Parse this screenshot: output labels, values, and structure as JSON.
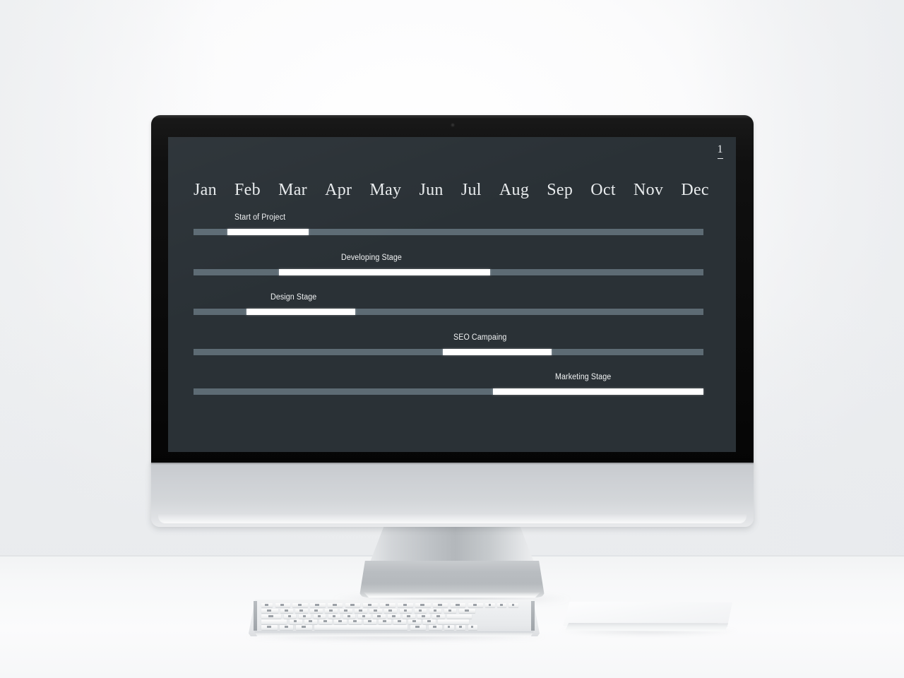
{
  "slide": {
    "page_number": "1",
    "screen_background": "#2a3136",
    "track_color": "#5d6b74",
    "fill_color": "#ffffff",
    "text_color": "#e8ebed"
  },
  "chart_data": {
    "type": "bar",
    "title": "",
    "subtitle": "",
    "xlabel": "",
    "ylabel": "",
    "grid": false,
    "legend": "none",
    "orientation": "horizontal",
    "axis_type": "timeline",
    "categories": [
      "Jan",
      "Feb",
      "Mar",
      "Apr",
      "May",
      "Jun",
      "Jul",
      "Aug",
      "Sep",
      "Oct",
      "Nov",
      "Dec"
    ],
    "xlim": [
      0,
      100
    ],
    "xtick_labels": [
      "Jan",
      "Feb",
      "Mar",
      "Apr",
      "May",
      "Jun",
      "Jul",
      "Aug",
      "Sep",
      "Oct",
      "Nov",
      "Dec"
    ],
    "series": [
      {
        "name": "Start of Project",
        "label": "Start of Project",
        "start_pct": 6.6,
        "end_pct": 22.6,
        "width_pct": 16.0,
        "start_month": "Feb",
        "end_month": "Mar",
        "label_align_pct": 8.1
      },
      {
        "name": "Developing Stage",
        "label": "Developing Stage",
        "start_pct": 16.7,
        "end_pct": 58.2,
        "width_pct": 41.5,
        "start_month": "Mar",
        "end_month": "Jul",
        "label_align_pct": 29.0
      },
      {
        "name": "Design Stage",
        "label": "Design Stage",
        "start_pct": 10.4,
        "end_pct": 31.7,
        "width_pct": 21.3,
        "start_month": "Feb",
        "end_month": "Apr",
        "label_align_pct": 15.1
      },
      {
        "name": "SEO Campaing",
        "label": "SEO Campaing",
        "start_pct": 48.9,
        "end_pct": 70.2,
        "width_pct": 21.3,
        "start_month": "Jun",
        "end_month": "Sep",
        "label_align_pct": 51.0
      },
      {
        "name": "Marketing Stage",
        "label": "Marketing Stage",
        "start_pct": 58.7,
        "end_pct": 100.0,
        "width_pct": 41.3,
        "start_month": "Jul",
        "end_month": "Dec",
        "label_align_pct": 70.9
      }
    ]
  },
  "hardware": {
    "display_name": "desktop-monitor",
    "keyboard_name": "wireless-keyboard",
    "trackpad_name": "wireless-trackpad",
    "webcam_name": "webcam"
  }
}
